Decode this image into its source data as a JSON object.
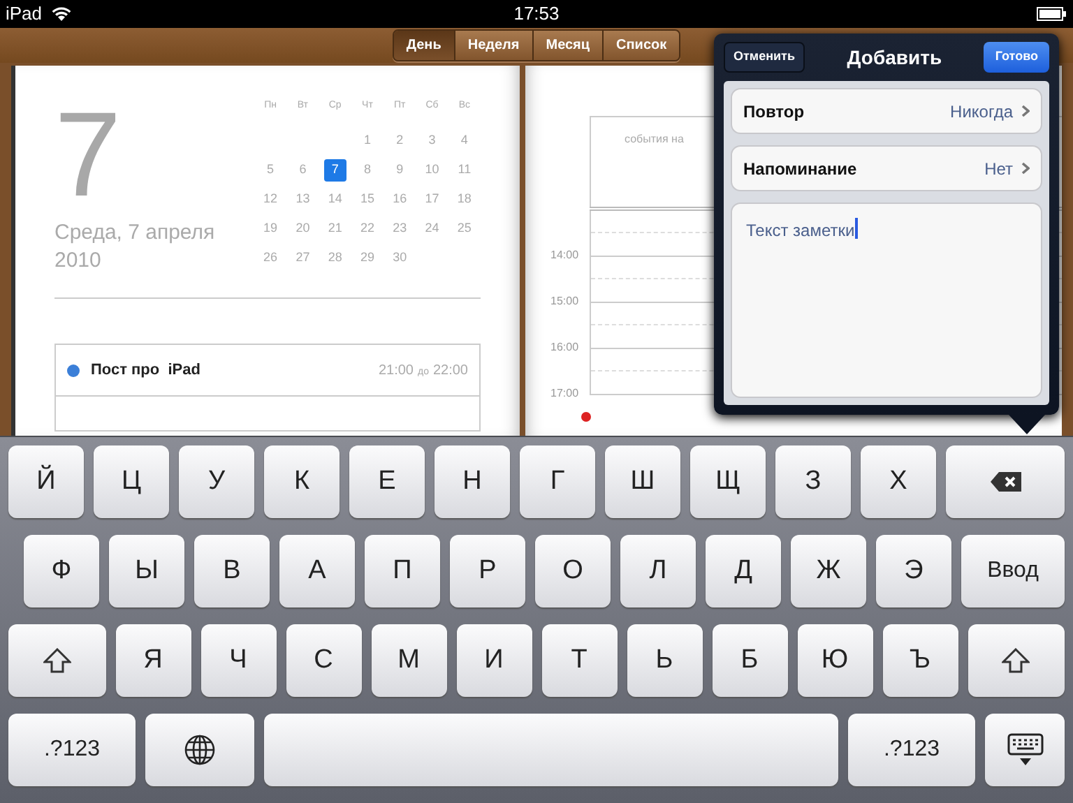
{
  "status_bar": {
    "carrier": "iPad",
    "time": "17:53"
  },
  "view_tabs": [
    {
      "label": "День",
      "selected": true
    },
    {
      "label": "Неделя",
      "selected": false
    },
    {
      "label": "Месяц",
      "selected": false
    },
    {
      "label": "Список",
      "selected": false
    }
  ],
  "day_page": {
    "day_number": "7",
    "date": "Среда, 7 апреля 2010",
    "mini_calendar": {
      "weekdays": [
        "Пн",
        "Вт",
        "Ср",
        "Чт",
        "Пт",
        "Сб",
        "Вс"
      ],
      "weeks": [
        [
          {
            "day": "1",
            "selected": false
          },
          {
            "day": "2",
            "selected": false
          },
          {
            "day": "3",
            "selected": false
          },
          {
            "day": "4",
            "selected": false
          }
        ],
        [
          {
            "day": "5",
            "selected": false
          },
          {
            "day": "6",
            "selected": false
          },
          {
            "day": "7",
            "selected": true
          },
          {
            "day": "8",
            "selected": false
          },
          {
            "day": "9",
            "selected": false
          },
          {
            "day": "10",
            "selected": false
          },
          {
            "day": "11",
            "selected": false
          }
        ],
        [
          {
            "day": "12",
            "selected": false
          },
          {
            "day": "13",
            "selected": false
          },
          {
            "day": "14",
            "selected": false
          },
          {
            "day": "15",
            "selected": false
          },
          {
            "day": "16",
            "selected": false
          },
          {
            "day": "17",
            "selected": false
          },
          {
            "day": "18",
            "selected": false
          }
        ],
        [
          {
            "day": "19",
            "selected": false
          },
          {
            "day": "20",
            "selected": false
          },
          {
            "day": "21",
            "selected": false
          },
          {
            "day": "22",
            "selected": false
          },
          {
            "day": "23",
            "selected": false
          },
          {
            "day": "24",
            "selected": false
          },
          {
            "day": "25",
            "selected": false
          }
        ],
        [
          {
            "day": "26",
            "selected": false
          },
          {
            "day": "27",
            "selected": false
          },
          {
            "day": "28",
            "selected": false
          },
          {
            "day": "29",
            "selected": false
          },
          {
            "day": "30",
            "selected": false
          }
        ]
      ]
    },
    "events": [
      {
        "title": "Пост про  iPad",
        "color": "#3b7fd8",
        "start": "21:00",
        "separator": "до",
        "end": "22:00"
      }
    ]
  },
  "timeline_page": {
    "all_day_label": "события на",
    "hours": [
      "14:00",
      "15:00",
      "16:00",
      "17:00"
    ]
  },
  "add_popover": {
    "cancel": "Отменить",
    "title": "Добавить",
    "done": "Готово",
    "rows": [
      {
        "label": "Повтор",
        "value": "Никогда"
      },
      {
        "label": "Напоминание",
        "value": "Нет"
      }
    ],
    "notes": {
      "value": "Текст заметки"
    }
  },
  "keyboard": {
    "rows": [
      {
        "keys": [
          {
            "kind": "letter",
            "label": "Й"
          },
          {
            "kind": "letter",
            "label": "Ц"
          },
          {
            "kind": "letter",
            "label": "У"
          },
          {
            "kind": "letter",
            "label": "К"
          },
          {
            "kind": "letter",
            "label": "Е"
          },
          {
            "kind": "letter",
            "label": "Н"
          },
          {
            "kind": "letter",
            "label": "Г"
          },
          {
            "kind": "letter",
            "label": "Ш"
          },
          {
            "kind": "letter",
            "label": "Щ"
          },
          {
            "kind": "letter",
            "label": "З"
          },
          {
            "kind": "letter",
            "label": "Х"
          },
          {
            "kind": "backspace"
          }
        ]
      },
      {
        "keys": [
          {
            "kind": "letter",
            "label": "Ф"
          },
          {
            "kind": "letter",
            "label": "Ы"
          },
          {
            "kind": "letter",
            "label": "В"
          },
          {
            "kind": "letter",
            "label": "А"
          },
          {
            "kind": "letter",
            "label": "П"
          },
          {
            "kind": "letter",
            "label": "Р"
          },
          {
            "kind": "letter",
            "label": "О"
          },
          {
            "kind": "letter",
            "label": "Л"
          },
          {
            "kind": "letter",
            "label": "Д"
          },
          {
            "kind": "letter",
            "label": "Ж"
          },
          {
            "kind": "letter",
            "label": "Э"
          },
          {
            "kind": "return",
            "label": "Ввод"
          }
        ]
      },
      {
        "keys": [
          {
            "kind": "shift"
          },
          {
            "kind": "letter",
            "label": "Я"
          },
          {
            "kind": "letter",
            "label": "Ч"
          },
          {
            "kind": "letter",
            "label": "С"
          },
          {
            "kind": "letter",
            "label": "М"
          },
          {
            "kind": "letter",
            "label": "И"
          },
          {
            "kind": "letter",
            "label": "Т"
          },
          {
            "kind": "letter",
            "label": "Ь"
          },
          {
            "kind": "letter",
            "label": "Б"
          },
          {
            "kind": "letter",
            "label": "Ю"
          },
          {
            "kind": "letter",
            "label": "Ъ"
          },
          {
            "kind": "shift"
          }
        ]
      },
      {
        "keys": [
          {
            "kind": "numbers",
            "label": ".?123"
          },
          {
            "kind": "globe"
          },
          {
            "kind": "space"
          },
          {
            "kind": "numbers",
            "label": ".?123"
          },
          {
            "kind": "hide"
          }
        ]
      }
    ]
  }
}
